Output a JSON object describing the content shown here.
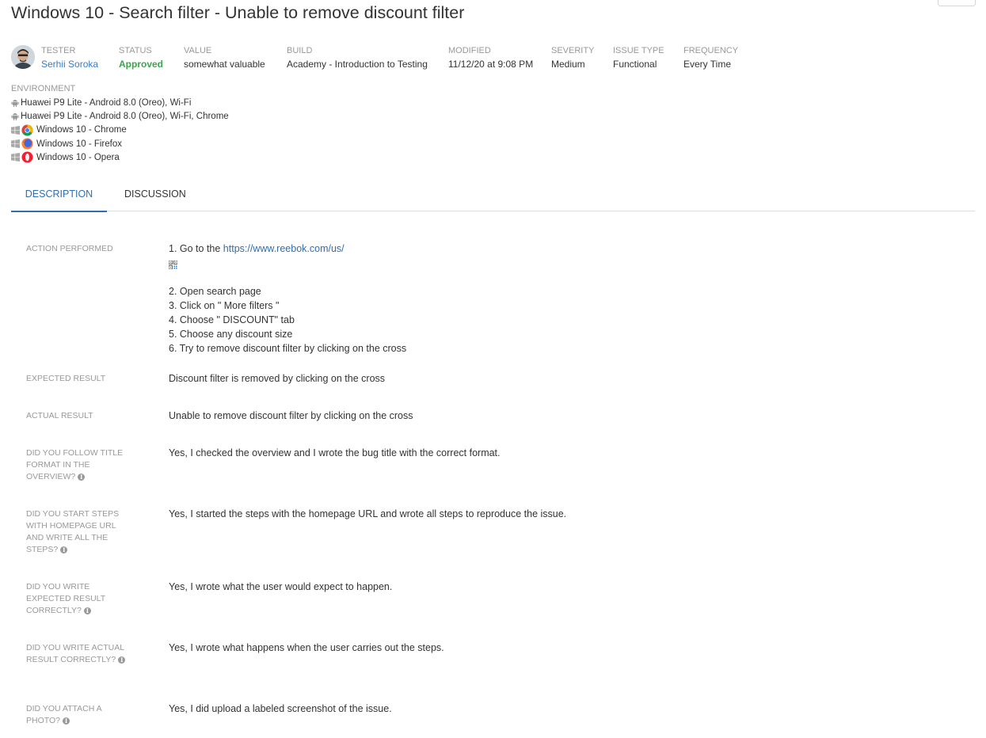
{
  "page": {
    "title": "Windows 10 - Search filter - Unable to remove discount filter"
  },
  "meta": {
    "tester": {
      "label": "TESTER",
      "value": "Serhii Soroka"
    },
    "status": {
      "label": "STATUS",
      "value": "Approved"
    },
    "value": {
      "label": "VALUE",
      "value": "somewhat valuable"
    },
    "build": {
      "label": "BUILD",
      "value": "Academy - Introduction to Testing"
    },
    "modified": {
      "label": "MODIFIED",
      "value": "11/12/20 at 9:08 PM"
    },
    "severity": {
      "label": "SEVERITY",
      "value": "Medium"
    },
    "issue_type": {
      "label": "ISSUE TYPE",
      "value": "Functional"
    },
    "frequency": {
      "label": "FREQUENCY",
      "value": "Every Time"
    }
  },
  "environment": {
    "label": "ENVIRONMENT",
    "items": [
      {
        "os_icon": "android-icon",
        "browser_icon": "",
        "text": "Huawei P9 Lite - Android 8.0 (Oreo), Wi-Fi"
      },
      {
        "os_icon": "android-icon",
        "browser_icon": "",
        "text": "Huawei P9 Lite - Android 8.0 (Oreo), Wi-Fi, Chrome"
      },
      {
        "os_icon": "windows-icon",
        "browser_icon": "chrome-icon",
        "text": "Windows 10 - Chrome"
      },
      {
        "os_icon": "windows-icon",
        "browser_icon": "firefox-icon",
        "text": "Windows 10 - Firefox"
      },
      {
        "os_icon": "windows-icon",
        "browser_icon": "opera-icon",
        "text": "Windows 10 - Opera"
      }
    ]
  },
  "tabs": [
    {
      "label": "DESCRIPTION",
      "active": true
    },
    {
      "label": "DISCUSSION",
      "active": false
    }
  ],
  "details": {
    "action_performed": {
      "label": "ACTION PERFORMED",
      "step1_prefix": "1. Go to the ",
      "step1_link": "https://www.reebok.com/us/",
      "steps": [
        "2. Open search page",
        "3. Click on \" More filters \"",
        "4. Choose \" DISCOUNT\" tab",
        "5. Choose any discount size",
        "6. Try to remove discount filter by clicking on the cross"
      ]
    },
    "expected_result": {
      "label": "EXPECTED RESULT",
      "value": "Discount filter is removed by clicking on the cross"
    },
    "actual_result": {
      "label": "ACTUAL RESULT",
      "value": "Unable to remove discount filter by clicking on the cross"
    },
    "q_title_format": {
      "label": "DID YOU FOLLOW TITLE FORMAT IN THE OVERVIEW?",
      "value": "Yes, I checked the overview and I wrote the bug title with the correct format."
    },
    "q_steps": {
      "label": "DID YOU START STEPS WITH HOMEPAGE URL AND WRITE ALL THE STEPS?",
      "value": "Yes, I started the steps with the homepage URL and wrote all steps to reproduce the issue."
    },
    "q_expected": {
      "label": "DID YOU WRITE EXPECTED RESULT CORRECTLY?",
      "value": "Yes, I wrote what the user would expect to happen."
    },
    "q_actual": {
      "label": "DID YOU WRITE ACTUAL RESULT CORRECTLY?",
      "value": "Yes, I wrote what happens when the user carries out the steps."
    },
    "q_photo": {
      "label": "DID YOU ATTACH A PHOTO?",
      "value": "Yes, I did upload a labeled screenshot of the issue."
    }
  },
  "colors": {
    "link": "#2f6fb0",
    "approved": "#3aa64b",
    "label_gray": "#999999"
  }
}
